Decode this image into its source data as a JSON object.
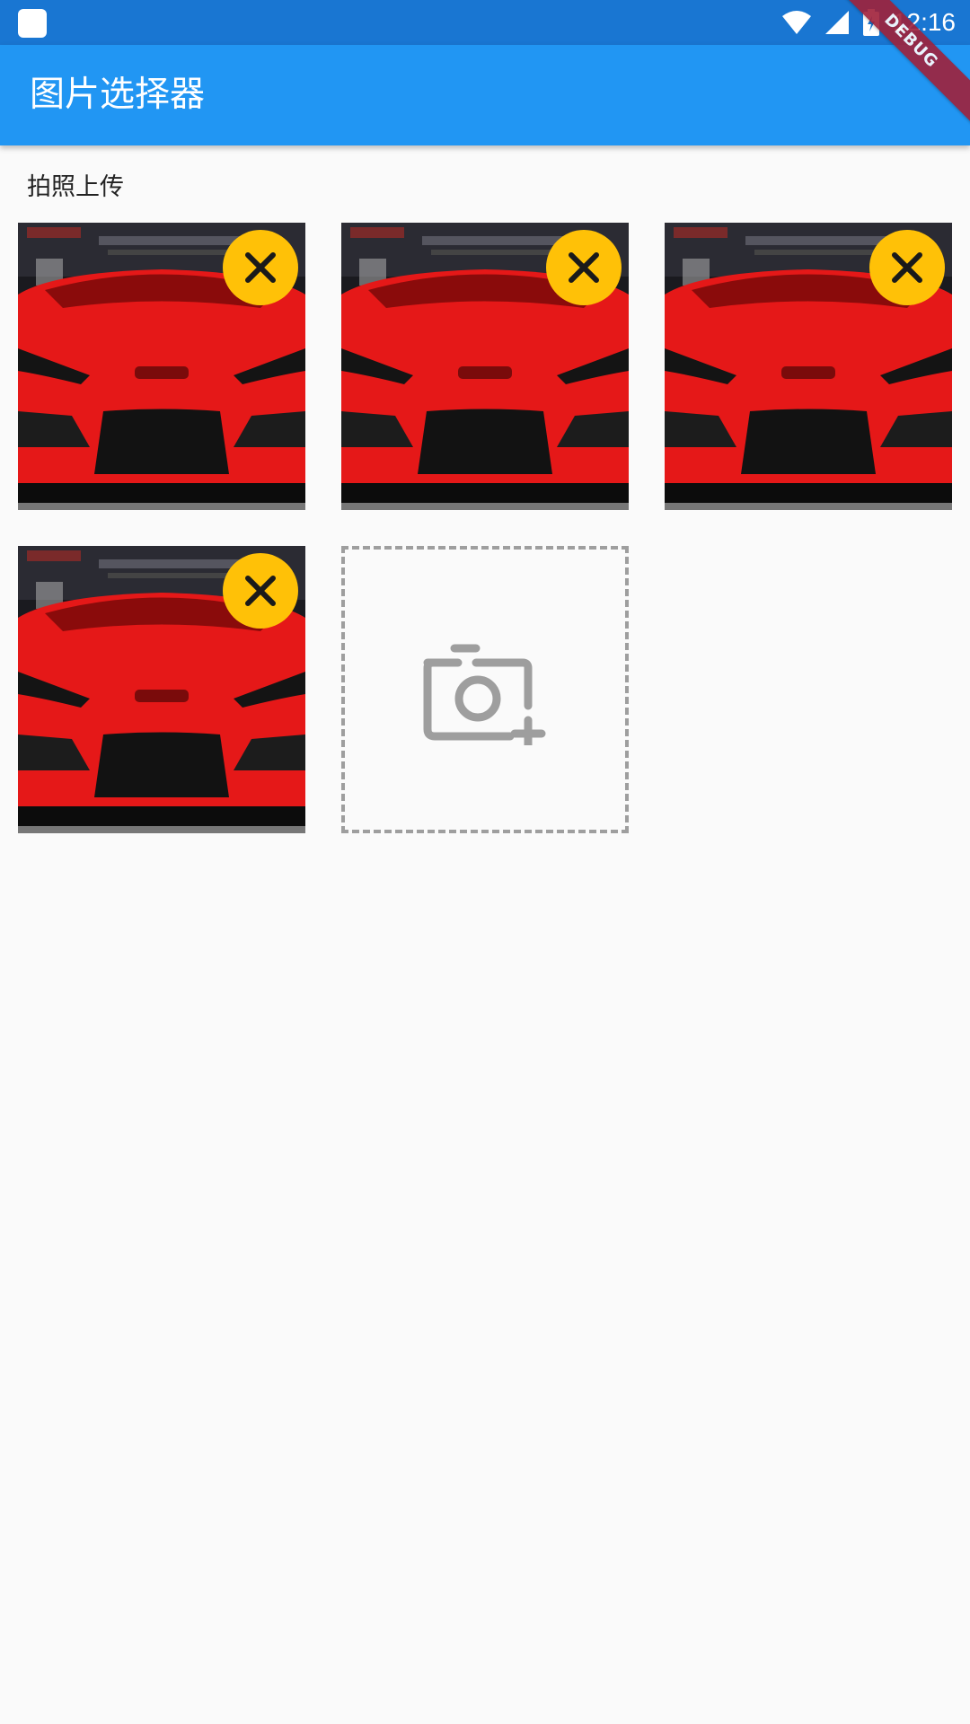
{
  "status_bar": {
    "time": "12:16",
    "icons": [
      "app-notification-icon",
      "wifi-icon",
      "signal-icon",
      "battery-charging-icon"
    ],
    "color": "#1976d2"
  },
  "app_bar": {
    "title": "图片选择器",
    "color": "#2196f3"
  },
  "debug_banner": "DEBUG",
  "section": {
    "label": "拍照上传"
  },
  "photos": [
    {
      "alt": "red car photo",
      "delete_icon": "close-icon"
    },
    {
      "alt": "red car photo",
      "delete_icon": "close-icon"
    },
    {
      "alt": "red car photo",
      "delete_icon": "close-icon"
    },
    {
      "alt": "red car photo",
      "delete_icon": "close-icon"
    }
  ],
  "add_photo": {
    "icon": "add-photo-camera-icon"
  },
  "colors": {
    "delete_button": "#ffc107",
    "dashed_border": "#9e9e9e",
    "background": "#fafafa"
  }
}
